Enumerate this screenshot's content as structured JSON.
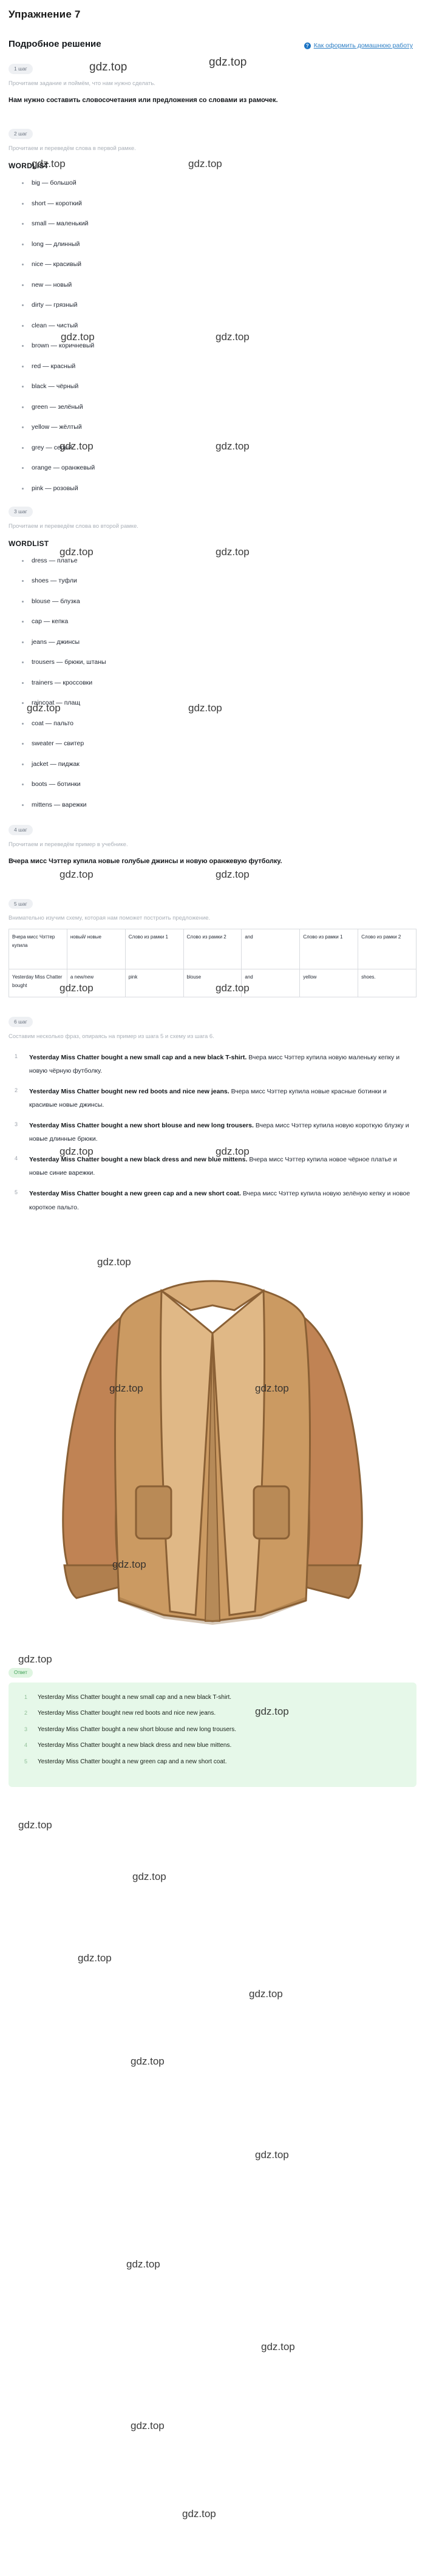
{
  "header": {
    "exercise_title": "Упражнение 7",
    "solution_title": "Подробное решение",
    "homework_link": "Как оформить домашнюю работу",
    "help_icon": "?"
  },
  "watermark": {
    "text": "gdz.top"
  },
  "steps": [
    {
      "badge": "1 шаг",
      "sub": "Прочитаем задание и поймём, что нам нужно сделать.",
      "body": "Нам нужно составить словосочетания или предложения со словами из рамочек."
    },
    {
      "badge": "2 шаг",
      "sub": "Прочитаем и переведём слова в первой рамке.",
      "wordlist_title": "WORDLIST"
    },
    {
      "badge": "3 шаг",
      "sub": "Прочитаем и переведём слова во второй рамке.",
      "wordlist_title": "WORDLIST"
    },
    {
      "badge": "4 шаг",
      "sub": "Прочитаем и переведём пример в учебнике.",
      "body": "Вчера мисс Чэттер купила новые голубые джинсы и новую оранжевую футболку."
    },
    {
      "badge": "5 шаг",
      "sub": "Внимательно изучим схему, которая нам поможет построить предложение."
    },
    {
      "badge": "6 шаг",
      "sub": "Составим несколько фраз, опираясь на пример из шага 5 и схему из шага 6."
    }
  ],
  "wordlist1": [
    "big — большой",
    "short — короткий",
    "small — маленький",
    "long — длинный",
    "nice — красивый",
    "new — новый",
    "dirty — грязный",
    "clean — чистый",
    "brown — коричневый",
    "red — красный",
    "black — чёрный",
    "green — зелёный",
    "yellow — жёлтый",
    "grey — серый",
    "orange — оранжевый",
    "pink — розовый"
  ],
  "wordlist2": [
    "dress — платье",
    "shoes — туфли",
    "blouse — блузка",
    "cap — кепка",
    "jeans — джинсы",
    "trousers — брюки, штаны",
    "trainers — кроссовки",
    "raincoat — плащ",
    "coat — пальто",
    "sweater — свитер",
    "jacket — пиджак",
    "boots — ботинки",
    "mittens — варежки"
  ],
  "scheme_table": {
    "header_row": [
      "Вчера мисс Чэттер купила",
      "новый/ новые",
      "Слово из рамки 1",
      "Слово из рамки 2",
      "and",
      "Слово из рамки 1",
      "Слово из рамки 2"
    ],
    "example_row": [
      "Yesterday Miss Chatter bought",
      "a new/new",
      "pink",
      "blouse",
      "and",
      "yellow",
      "shoes."
    ]
  },
  "phrases": [
    {
      "en": "Yesterday Miss Chatter bought a new small cap and a new black T-shirt.",
      "ru": "Вчера мисс Чэттер купила новую маленьку кепку и новую чёрную футболку."
    },
    {
      "en": "Yesterday Miss Chatter bought new red boots and nice new jeans.",
      "ru": "Вчера мисс Чэттер купила новые красные ботинки и красивые новые джинсы."
    },
    {
      "en": "Yesterday Miss Chatter bought a new short blouse and new long trousers.",
      "ru": "Вчера мисс Чэттер купила новую короткую блузку и новые длинные брюки."
    },
    {
      "en": "Yesterday Miss Chatter bought a new black dress and new blue mittens.",
      "ru": "Вчера мисс Чэттер купила новое чёрное платье и новые синие варежки."
    },
    {
      "en": "Yesterday Miss Chatter bought a new green cap and a new short coat.",
      "ru": "Вчера мисс Чэттер купила новую зелёную кепку и новое короткое пальто."
    }
  ],
  "answer": {
    "badge": "Ответ",
    "items": [
      "Yesterday Miss Chatter bought a new small cap and a new black T-shirt.",
      "Yesterday Miss Chatter bought new red boots and nice new jeans.",
      "Yesterday Miss Chatter bought a new short blouse and new long trousers.",
      "Yesterday Miss Chatter bought a new black dress and new blue mittens.",
      "Yesterday Miss Chatter bought a new green cap and a new short coat."
    ]
  },
  "illustration": {
    "name": "beige-coat-illustration",
    "colors": {
      "body": "#c99a63",
      "lapel": "#e0b886",
      "sleeve_dark": "#b07f4e",
      "inner": "#caa06f",
      "outline": "#8a6035"
    }
  }
}
